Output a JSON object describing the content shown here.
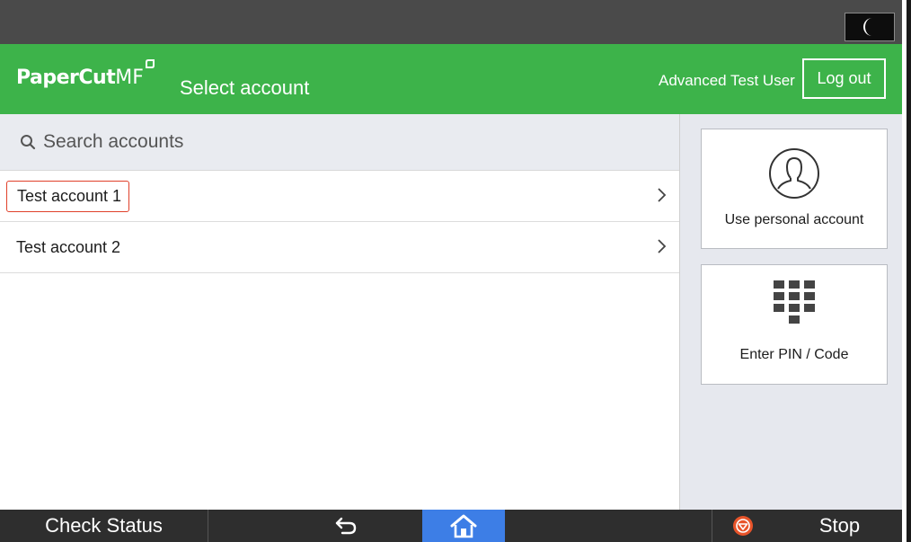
{
  "header": {
    "brand": "PaperCut",
    "brand_suffix": "MF",
    "title": "Select account",
    "user_name": "Advanced Test User",
    "logout_label": "Log out"
  },
  "search": {
    "placeholder": "Search accounts"
  },
  "accounts": [
    {
      "label": "Test account 1",
      "highlighted": true
    },
    {
      "label": "Test account 2",
      "highlighted": false
    }
  ],
  "options": {
    "personal_label": "Use personal account",
    "pin_label": "Enter PIN / Code"
  },
  "bottom_bar": {
    "check_status_label": "Check Status",
    "stop_label": "Stop"
  },
  "icons": {
    "sleep": "moon-icon",
    "search": "search-icon",
    "chevron": "chevron-right-icon",
    "personal": "person-icon",
    "pin": "keypad-icon",
    "back": "back-arrow-icon",
    "home": "home-icon",
    "stop": "stop-icon"
  },
  "colors": {
    "header_green": "#3db34a",
    "highlight_red": "#e0402a",
    "home_blue": "#3d7ee6",
    "stop_orange": "#e8542a"
  }
}
